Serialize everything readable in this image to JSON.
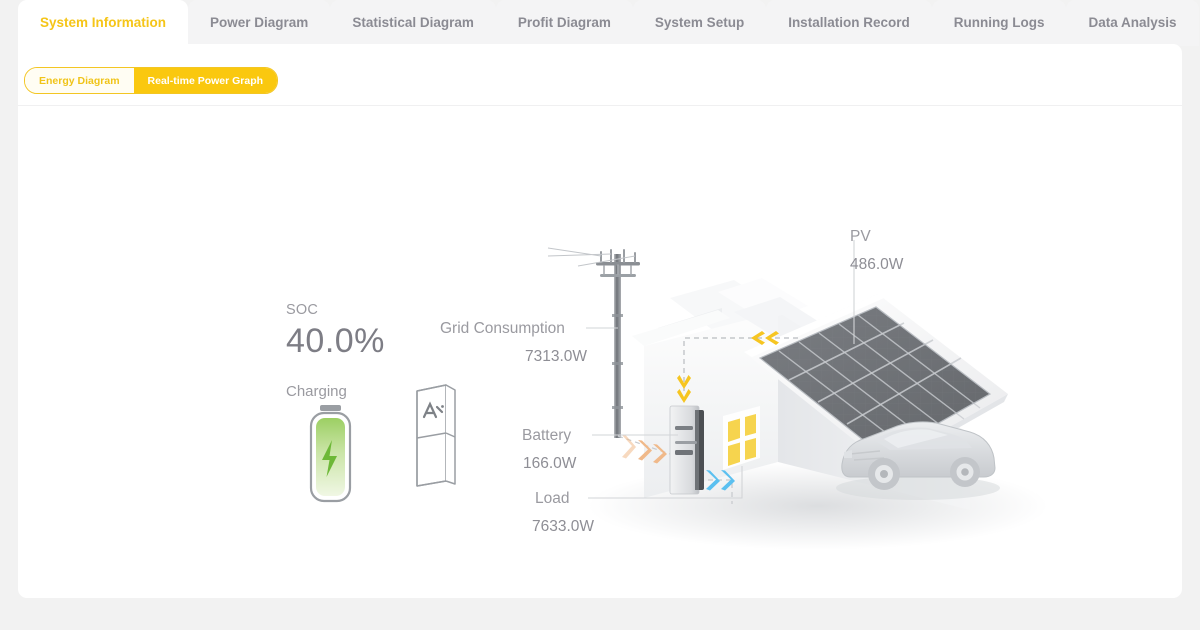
{
  "tabs": [
    {
      "label": "System Information",
      "active": true
    },
    {
      "label": "Power Diagram",
      "active": false
    },
    {
      "label": "Statistical Diagram",
      "active": false
    },
    {
      "label": "Profit Diagram",
      "active": false
    },
    {
      "label": "System Setup",
      "active": false
    },
    {
      "label": "Installation Record",
      "active": false
    },
    {
      "label": "Running Logs",
      "active": false
    },
    {
      "label": "Data Analysis",
      "active": false
    }
  ],
  "view_toggle": {
    "options": [
      {
        "label": "Energy Diagram",
        "selected": false
      },
      {
        "label": "Real-time Power Graph",
        "selected": true
      }
    ]
  },
  "soc": {
    "label": "SOC",
    "value": "40.0%",
    "status": "Charging"
  },
  "flows": {
    "pv": {
      "label": "PV",
      "value": "486.0W"
    },
    "grid": {
      "label": "Grid Consumption",
      "value": "7313.0W"
    },
    "battery": {
      "label": "Battery",
      "value": "166.0W"
    },
    "load": {
      "label": "Load",
      "value": "7633.0W"
    }
  },
  "colors": {
    "accent": "#fac80f",
    "accent_text": "#f5c518",
    "tab_inactive_text": "#8b8b93",
    "label_text": "#9a9aa0",
    "value_text": "#8e8e95",
    "panel_bg": "#ffffff",
    "page_bg": "#f2f2f2",
    "arrow_grid": "#f0b98a",
    "arrow_load": "#5bc0f0",
    "arrow_pv": "#f6c521",
    "battery_green": "#7ec14a",
    "panel_dark": "#6f7276"
  },
  "icons": {
    "battery": "battery-charging-icon",
    "cabinet": "battery-cabinet-icon",
    "pole": "utility-pole-icon",
    "house": "house-with-solar-icon",
    "inverter": "inverter-icon",
    "car": "electric-car-icon"
  }
}
